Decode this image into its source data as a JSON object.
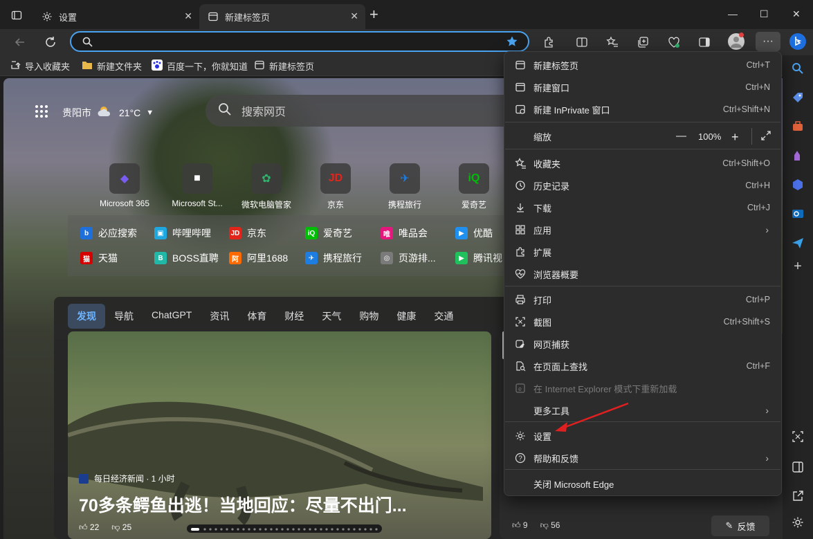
{
  "tabs": [
    {
      "label": "设置",
      "icon": "gear-icon"
    },
    {
      "label": "新建标签页",
      "icon": "newtab-icon"
    }
  ],
  "address": {
    "value": "",
    "placeholder": ""
  },
  "bookmarks": [
    {
      "label": "导入收藏夹",
      "icon": "import-icon"
    },
    {
      "label": "新建文件夹",
      "icon": "folder-icon"
    },
    {
      "label": "百度一下，你就知道",
      "icon": "baidu-icon"
    },
    {
      "label": "新建标签页",
      "icon": "newtab-icon"
    }
  ],
  "newtab": {
    "weather": {
      "city": "贵阳市",
      "temp": "21°C"
    },
    "search_placeholder": "搜索网页",
    "tiles": [
      {
        "label": "Microsoft 365",
        "glyph": "◆",
        "color": "#7b5cf0"
      },
      {
        "label": "Microsoft St...",
        "glyph": "■",
        "color": "#ffffff"
      },
      {
        "label": "微软电脑管家",
        "glyph": "✿",
        "color": "#2fb36d"
      },
      {
        "label": "京东",
        "glyph": "JD",
        "color": "#e1251b"
      },
      {
        "label": "携程旅行",
        "glyph": "✈",
        "color": "#1e7de0"
      },
      {
        "label": "爱奇艺",
        "glyph": "iQ",
        "color": "#00be06"
      }
    ],
    "quicklinks_row1": [
      {
        "label": "必应搜索",
        "glyph": "b",
        "color": "#1e6fd9"
      },
      {
        "label": "哔哩哔哩",
        "glyph": "▣",
        "color": "#1fa7e0"
      },
      {
        "label": "京东",
        "glyph": "JD",
        "color": "#e1251b"
      },
      {
        "label": "爱奇艺",
        "glyph": "iQ",
        "color": "#00be06"
      },
      {
        "label": "唯品会",
        "glyph": "唯",
        "color": "#e5177c"
      },
      {
        "label": "优酷",
        "glyph": "▶",
        "color": "#1f8ff0"
      }
    ],
    "quicklinks_row2": [
      {
        "label": "天猫",
        "glyph": "猫",
        "color": "#d40000"
      },
      {
        "label": "BOSS直聘",
        "glyph": "B",
        "color": "#22b8a8"
      },
      {
        "label": "阿里1688",
        "glyph": "阿",
        "color": "#ff6a00"
      },
      {
        "label": "携程旅行",
        "glyph": "✈",
        "color": "#1e7de0"
      },
      {
        "label": "页游排...",
        "glyph": "◎",
        "color": "#7a7a7a"
      },
      {
        "label": "腾讯视",
        "glyph": "▶",
        "color": "#20c05c"
      }
    ],
    "feed_tabs": [
      "发现",
      "导航",
      "ChatGPT",
      "资讯",
      "体育",
      "财经",
      "天气",
      "购物",
      "健康",
      "交通"
    ],
    "card": {
      "source": "每日经济新闻 · 1 小时",
      "title": "70多条鳄鱼出逃！当地回应：尽量不出门...",
      "likes": "22",
      "dislikes": "25"
    },
    "card2": {
      "likes": "9",
      "dislikes": "56"
    },
    "feedback_label": "反馈"
  },
  "menu": {
    "items": [
      {
        "label": "新建标签页",
        "shortcut": "Ctrl+T",
        "icon": "newtab-icon"
      },
      {
        "label": "新建窗口",
        "shortcut": "Ctrl+N",
        "icon": "window-icon"
      },
      {
        "label": "新建 InPrivate 窗口",
        "shortcut": "Ctrl+Shift+N",
        "icon": "inprivate-icon"
      },
      {
        "label": "缩放",
        "zoom": "100%"
      },
      {
        "label": "收藏夹",
        "shortcut": "Ctrl+Shift+O",
        "icon": "favorites-icon"
      },
      {
        "label": "历史记录",
        "shortcut": "Ctrl+H",
        "icon": "history-icon"
      },
      {
        "label": "下载",
        "shortcut": "Ctrl+J",
        "icon": "download-icon"
      },
      {
        "label": "应用",
        "shortcut": "",
        "icon": "apps-icon"
      },
      {
        "label": "扩展",
        "shortcut": "",
        "icon": "extensions-icon"
      },
      {
        "label": "浏览器概要",
        "shortcut": "",
        "icon": "heartbeat-icon"
      },
      {
        "label": "打印",
        "shortcut": "Ctrl+P",
        "icon": "print-icon"
      },
      {
        "label": "截图",
        "shortcut": "Ctrl+Shift+S",
        "icon": "screenshot-icon"
      },
      {
        "label": "网页捕获",
        "shortcut": "",
        "icon": "capture-icon"
      },
      {
        "label": "在页面上查找",
        "shortcut": "Ctrl+F",
        "icon": "find-icon"
      },
      {
        "label": "在 Internet Explorer 模式下重新加载",
        "shortcut": "",
        "icon": "ie-icon"
      },
      {
        "label": "更多工具",
        "shortcut": "",
        "icon": ""
      },
      {
        "label": "设置",
        "shortcut": "",
        "icon": "gear-icon"
      },
      {
        "label": "帮助和反馈",
        "shortcut": "",
        "icon": "help-icon"
      },
      {
        "label": "关闭 Microsoft Edge",
        "shortcut": "",
        "icon": ""
      }
    ]
  },
  "colors": {
    "accent": "#4aa3f0",
    "arrow": "#e02020",
    "menu_bg": "#2c2c2c"
  }
}
